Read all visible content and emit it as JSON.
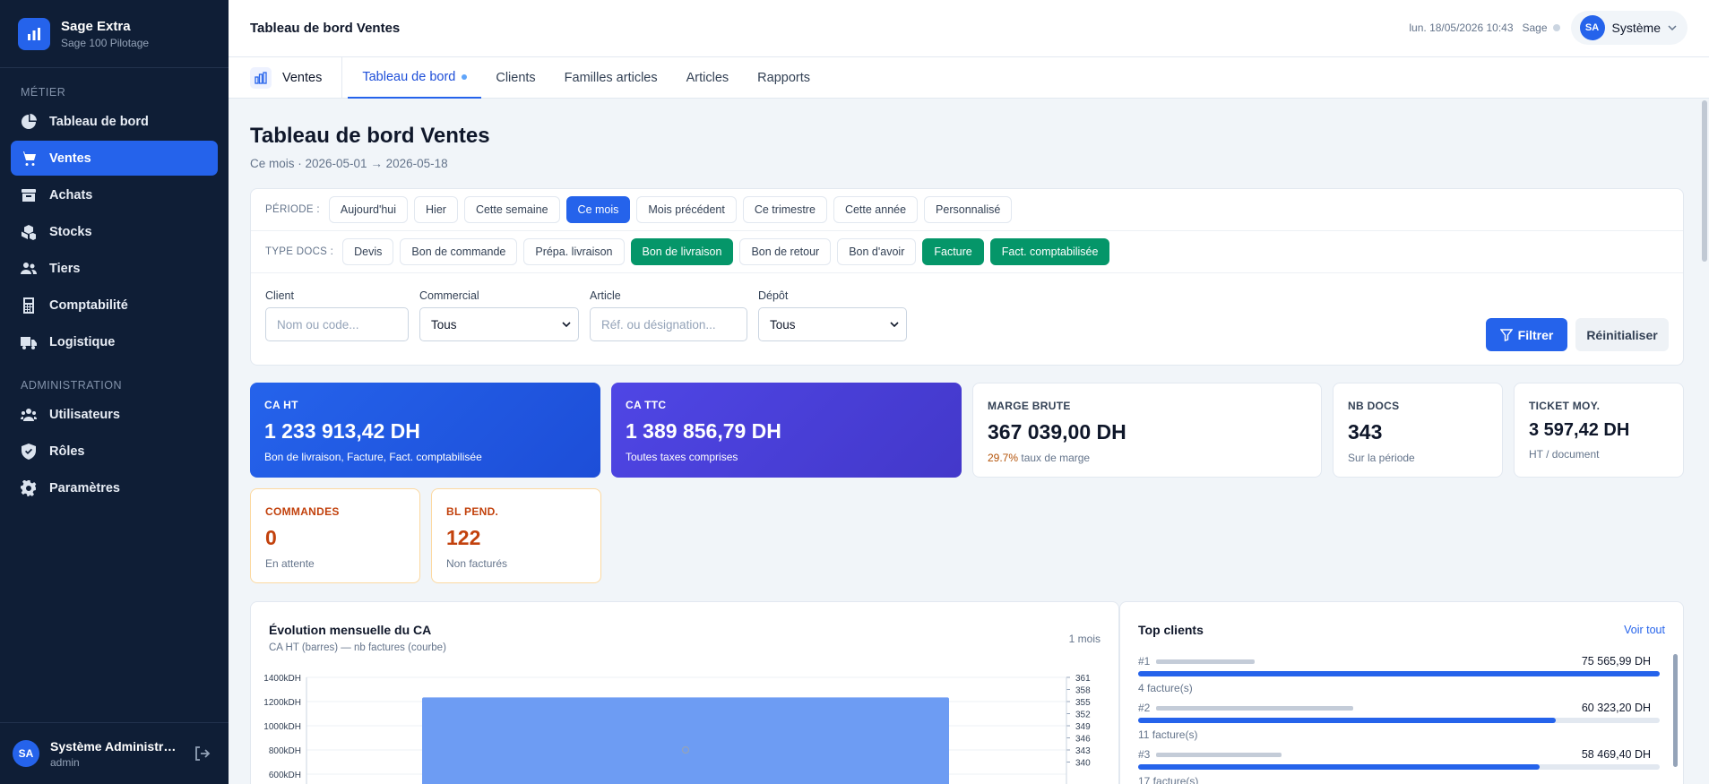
{
  "sidebar": {
    "brand_name": "Sage Extra",
    "brand_sub": "Sage 100 Pilotage",
    "section_metier": "MÉTIER",
    "section_admin": "ADMINISTRATION",
    "items": [
      {
        "label": "Tableau de bord",
        "icon": "pie-chart-icon"
      },
      {
        "label": "Ventes",
        "icon": "cart-icon",
        "active": true
      },
      {
        "label": "Achats",
        "icon": "archive-icon"
      },
      {
        "label": "Stocks",
        "icon": "cubes-icon"
      },
      {
        "label": "Tiers",
        "icon": "users-icon"
      },
      {
        "label": "Comptabilité",
        "icon": "calculator-icon"
      },
      {
        "label": "Logistique",
        "icon": "truck-icon"
      }
    ],
    "admin_items": [
      {
        "label": "Utilisateurs",
        "icon": "user-group-icon"
      },
      {
        "label": "Rôles",
        "icon": "shield-icon"
      },
      {
        "label": "Paramètres",
        "icon": "gear-icon"
      }
    ],
    "user": {
      "initials": "SA",
      "name": "Système Administrat...",
      "role": "admin"
    }
  },
  "topbar": {
    "title": "Tableau de bord Ventes",
    "datetime": "lun. 18/05/2026 10:43",
    "sage_label": "Sage",
    "user_initials": "SA",
    "user_name": "Système"
  },
  "tabs": {
    "module": "Ventes",
    "items": [
      "Tableau de bord",
      "Clients",
      "Familles articles",
      "Articles",
      "Rapports"
    ]
  },
  "page": {
    "title": "Tableau de bord Ventes",
    "subtitle": "Ce mois · 2026-05-01 → 2026-05-18"
  },
  "filters": {
    "period_label": "PÉRIODE :",
    "periods": [
      "Aujourd'hui",
      "Hier",
      "Cette semaine",
      "Ce mois",
      "Mois précédent",
      "Ce trimestre",
      "Cette année",
      "Personnalisé"
    ],
    "period_selected": "Ce mois",
    "doc_label": "TYPE DOCS :",
    "doc_types": [
      "Devis",
      "Bon de commande",
      "Prépa. livraison",
      "Bon de livraison",
      "Bon de retour",
      "Bon d'avoir",
      "Facture",
      "Fact. comptabilisée"
    ],
    "doc_selected": [
      "Bon de livraison",
      "Facture",
      "Fact. comptabilisée"
    ],
    "client_label": "Client",
    "client_placeholder": "Nom ou code...",
    "commercial_label": "Commercial",
    "commercial_value": "Tous",
    "article_label": "Article",
    "article_placeholder": "Réf. ou désignation...",
    "depot_label": "Dépôt",
    "depot_value": "Tous",
    "filter_button": "Filtrer",
    "reset_button": "Réinitialiser"
  },
  "kpis": {
    "ca_ht": {
      "label": "CA HT",
      "value": "1 233 913,42 DH",
      "sub": "Bon de livraison, Facture, Fact. comptabilisée"
    },
    "ca_ttc": {
      "label": "CA TTC",
      "value": "1 389 856,79 DH",
      "sub": "Toutes taxes comprises"
    },
    "marge": {
      "label": "MARGE BRUTE",
      "value": "367 039,00 DH",
      "rate": "29.7%",
      "sub": "taux de marge"
    },
    "nb_docs": {
      "label": "NB DOCS",
      "value": "343",
      "sub": "Sur la période"
    },
    "ticket": {
      "label": "TICKET MOY.",
      "value": "3 597,42 DH",
      "sub": "HT / document"
    },
    "commandes": {
      "label": "COMMANDES",
      "value": "0",
      "sub": "En attente"
    },
    "bl_pend": {
      "label": "BL PEND.",
      "value": "122",
      "sub": "Non facturés"
    }
  },
  "evolution": {
    "title": "Évolution mensuelle du CA",
    "subtitle": "CA HT (barres) — nb factures (courbe)",
    "period": "1 mois"
  },
  "chart_data": {
    "type": "bar",
    "title": "Évolution mensuelle du CA",
    "subtitle": "CA HT (barres) — nb factures (courbe)",
    "y_left_ticks": [
      "1400kDH",
      "1200kDH",
      "1000kDH",
      "800kDH",
      "600kDH"
    ],
    "y_right_ticks": [
      "361",
      "358",
      "355",
      "352",
      "349",
      "346",
      "343",
      "340"
    ],
    "ylim_left": [
      0,
      1400
    ],
    "series": [
      {
        "type": "bar",
        "values": [
          1233.91
        ]
      },
      {
        "type": "line",
        "values": [
          343
        ]
      }
    ]
  },
  "top_clients": {
    "title": "Top clients",
    "link": "Voir tout",
    "rows": [
      {
        "rank": "#1",
        "amount": "75 565,99 DH",
        "count": "4 facture(s)",
        "share": 1.0
      },
      {
        "rank": "#2",
        "amount": "60 323,20 DH",
        "count": "11 facture(s)",
        "share": 0.8
      },
      {
        "rank": "#3",
        "amount": "58 469,40 DH",
        "count": "17 facture(s)",
        "share": 0.77
      }
    ]
  },
  "colors": {
    "primary": "#2563eb",
    "sidebar": "#0f1e36",
    "green": "#059669",
    "orange": "#c2410c",
    "indigo": "#4f46e5"
  }
}
